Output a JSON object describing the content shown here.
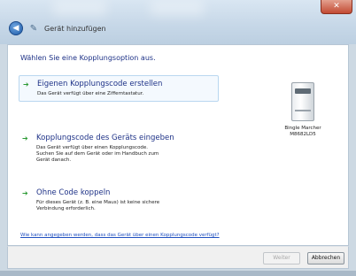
{
  "window": {
    "title": "Gerät hinzufügen",
    "close_label": "✕",
    "back_glyph": "◀",
    "wizard_glyph": "✎"
  },
  "heading": "Wählen Sie eine Kopplungsoption aus.",
  "options": [
    {
      "title": "Eigenen Kopplungscode erstellen",
      "description": "Das Gerät verfügt über eine Zifferntastatur."
    },
    {
      "title": "Kopplungscode des Geräts eingeben",
      "description": "Das Gerät verfügt über einen Kopplungscode.\nSuchen Sie auf dem Gerät oder im Handbuch zum\nGerät danach."
    },
    {
      "title": "Ohne Code koppeln",
      "description": "Für dieses Gerät (z. B. eine Maus) ist keine sichere\nVerbindung erforderlich."
    }
  ],
  "option_arrow": "➔",
  "device": {
    "icon": "printer-icon",
    "label": "Bingle Marcher\nM8682LD5"
  },
  "help_link": "Wie kann angegeben werden, dass das Gerät über einen Kopplungscode verfügt?",
  "buttons": {
    "next": "Weiter",
    "cancel": "Abbrechen"
  },
  "colors": {
    "heading": "#1e3287",
    "link": "#2050c0",
    "arrow": "#2c9a34",
    "close": "#c24a33"
  }
}
